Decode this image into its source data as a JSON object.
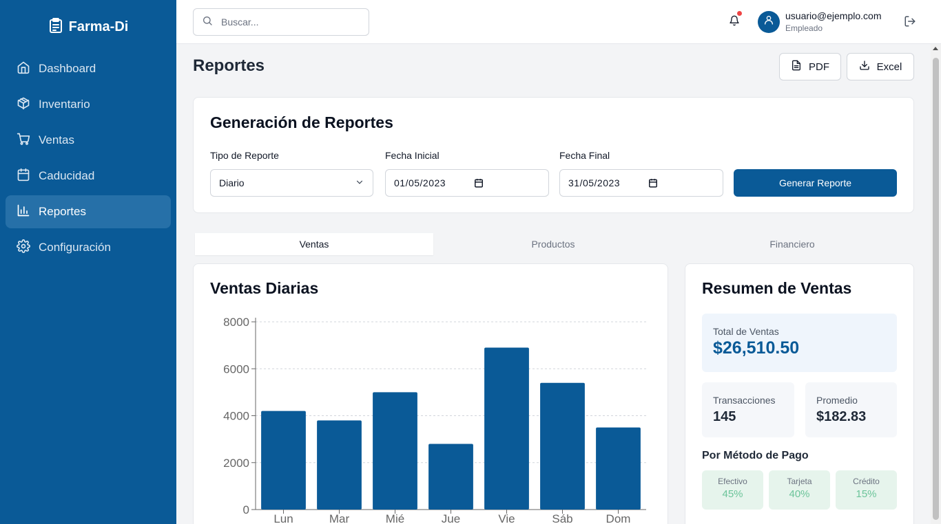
{
  "app": {
    "name": "Farma-Di"
  },
  "sidebar": {
    "items": [
      {
        "label": "Dashboard",
        "icon": "home-icon"
      },
      {
        "label": "Inventario",
        "icon": "box-icon"
      },
      {
        "label": "Ventas",
        "icon": "cart-icon"
      },
      {
        "label": "Caducidad",
        "icon": "calendar-icon"
      },
      {
        "label": "Reportes",
        "icon": "bar-chart-icon",
        "active": true
      },
      {
        "label": "Configuración",
        "icon": "gear-icon"
      }
    ]
  },
  "header": {
    "search_placeholder": "Buscar...",
    "user_email": "usuario@ejemplo.com",
    "user_role": "Empleado"
  },
  "page": {
    "title": "Reportes",
    "pdf_label": "PDF",
    "excel_label": "Excel"
  },
  "report_form": {
    "title": "Generación de Reportes",
    "type_label": "Tipo de Reporte",
    "type_value": "Diario",
    "start_label": "Fecha Inicial",
    "start_value": "01/05/2023",
    "end_label": "Fecha Final",
    "end_value": "31/05/2023",
    "generate_label": "Generar Reporte"
  },
  "tabs": [
    {
      "label": "Ventas",
      "active": true
    },
    {
      "label": "Productos"
    },
    {
      "label": "Financiero"
    }
  ],
  "chart_card": {
    "title": "Ventas Diarias"
  },
  "chart_data": {
    "type": "bar",
    "title": "Ventas Diarias",
    "categories": [
      "Lun",
      "Mar",
      "Mié",
      "Jue",
      "Vie",
      "Sáb",
      "Dom"
    ],
    "values": [
      4200,
      3800,
      5000,
      2800,
      6900,
      5400,
      3500
    ],
    "ylim": [
      0,
      8000
    ],
    "yticks": [
      0,
      2000,
      4000,
      6000,
      8000
    ],
    "grid": true,
    "color": "#0a5a97"
  },
  "summary": {
    "title": "Resumen de Ventas",
    "total_label": "Total de Ventas",
    "total_value": "$26,510.50",
    "transactions_label": "Transacciones",
    "transactions_value": "145",
    "average_label": "Promedio",
    "average_value": "$182.83",
    "payment_title": "Por Método de Pago",
    "payments": [
      {
        "name": "Efectivo",
        "pct": "45%"
      },
      {
        "name": "Tarjeta",
        "pct": "40%"
      },
      {
        "name": "Crédito",
        "pct": "15%"
      }
    ]
  },
  "colors": {
    "primary": "#0a5a97",
    "accent_green": "#6cc49a",
    "notification": "#ef4444"
  }
}
